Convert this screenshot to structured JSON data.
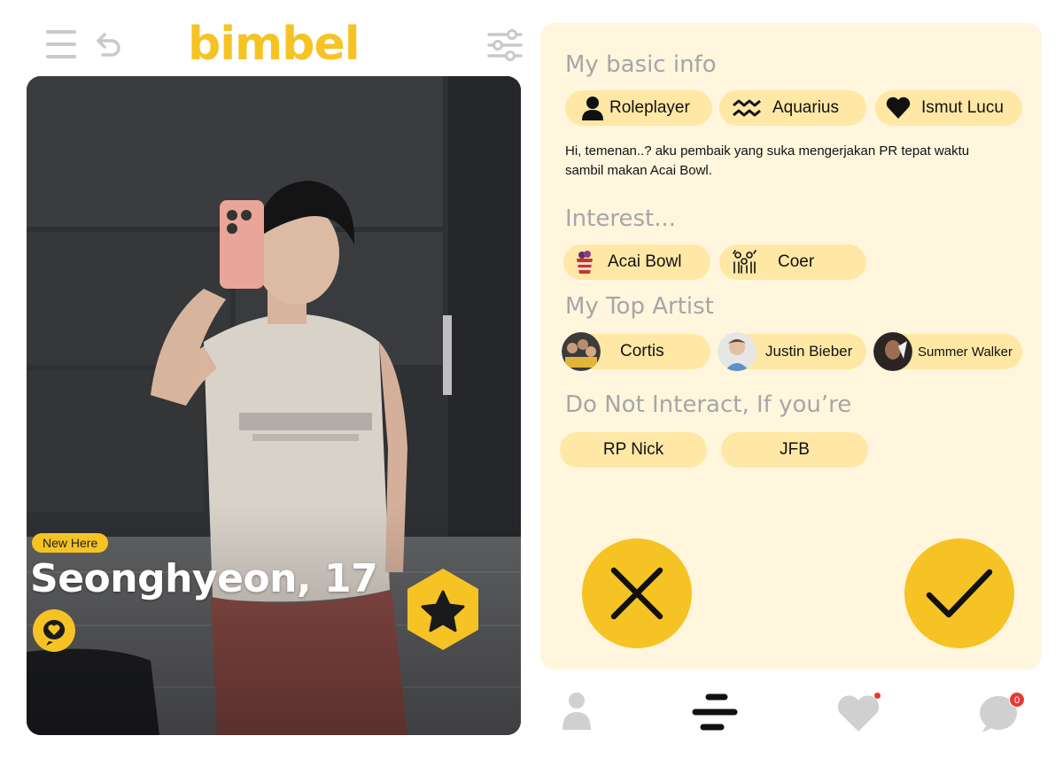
{
  "app": {
    "brand": "bimbel"
  },
  "header": {
    "menu_icon": "hamburger-icon",
    "undo_icon": "undo-icon",
    "filter_icon": "sliders-icon"
  },
  "profile": {
    "badge": "New Here",
    "name_age": "Seonghyeon, 17",
    "basic_info_title": "My basic info",
    "basic_info": [
      {
        "label": "Roleplayer",
        "icon": "person-icon"
      },
      {
        "label": "Aquarius",
        "icon": "aquarius-icon"
      },
      {
        "label": "Ismut Lucu",
        "icon": "heart-icon"
      }
    ],
    "bio": "Hi, temenan..? aku pembaik yang suka mengerjakan PR tepat waktu sambil makan Acai Bowl.",
    "interest_title": "Interest...",
    "interests": [
      {
        "label": "Acai Bowl",
        "icon": "acai-bowl-icon"
      },
      {
        "label": "Coer",
        "icon": "cheering-crowd-icon"
      }
    ],
    "artists_title": "My Top Artist",
    "artists": [
      {
        "label": "Cortis"
      },
      {
        "label": "Justin Bieber"
      },
      {
        "label": "Summer Walker"
      }
    ],
    "dni_title": "Do Not Interact, If you’re",
    "dni": [
      {
        "label": "RP Nick"
      },
      {
        "label": "JFB"
      }
    ]
  },
  "actions": {
    "reject_icon": "close-icon",
    "accept_icon": "check-icon"
  },
  "nav": {
    "items": [
      "profile-icon",
      "stack-icon",
      "likes-icon",
      "messages-icon"
    ],
    "messages_count": "0"
  },
  "colors": {
    "accent": "#f6c325",
    "pill": "#ffe8a6",
    "panel": "#fff6dd",
    "muted": "#a6a6a6"
  }
}
